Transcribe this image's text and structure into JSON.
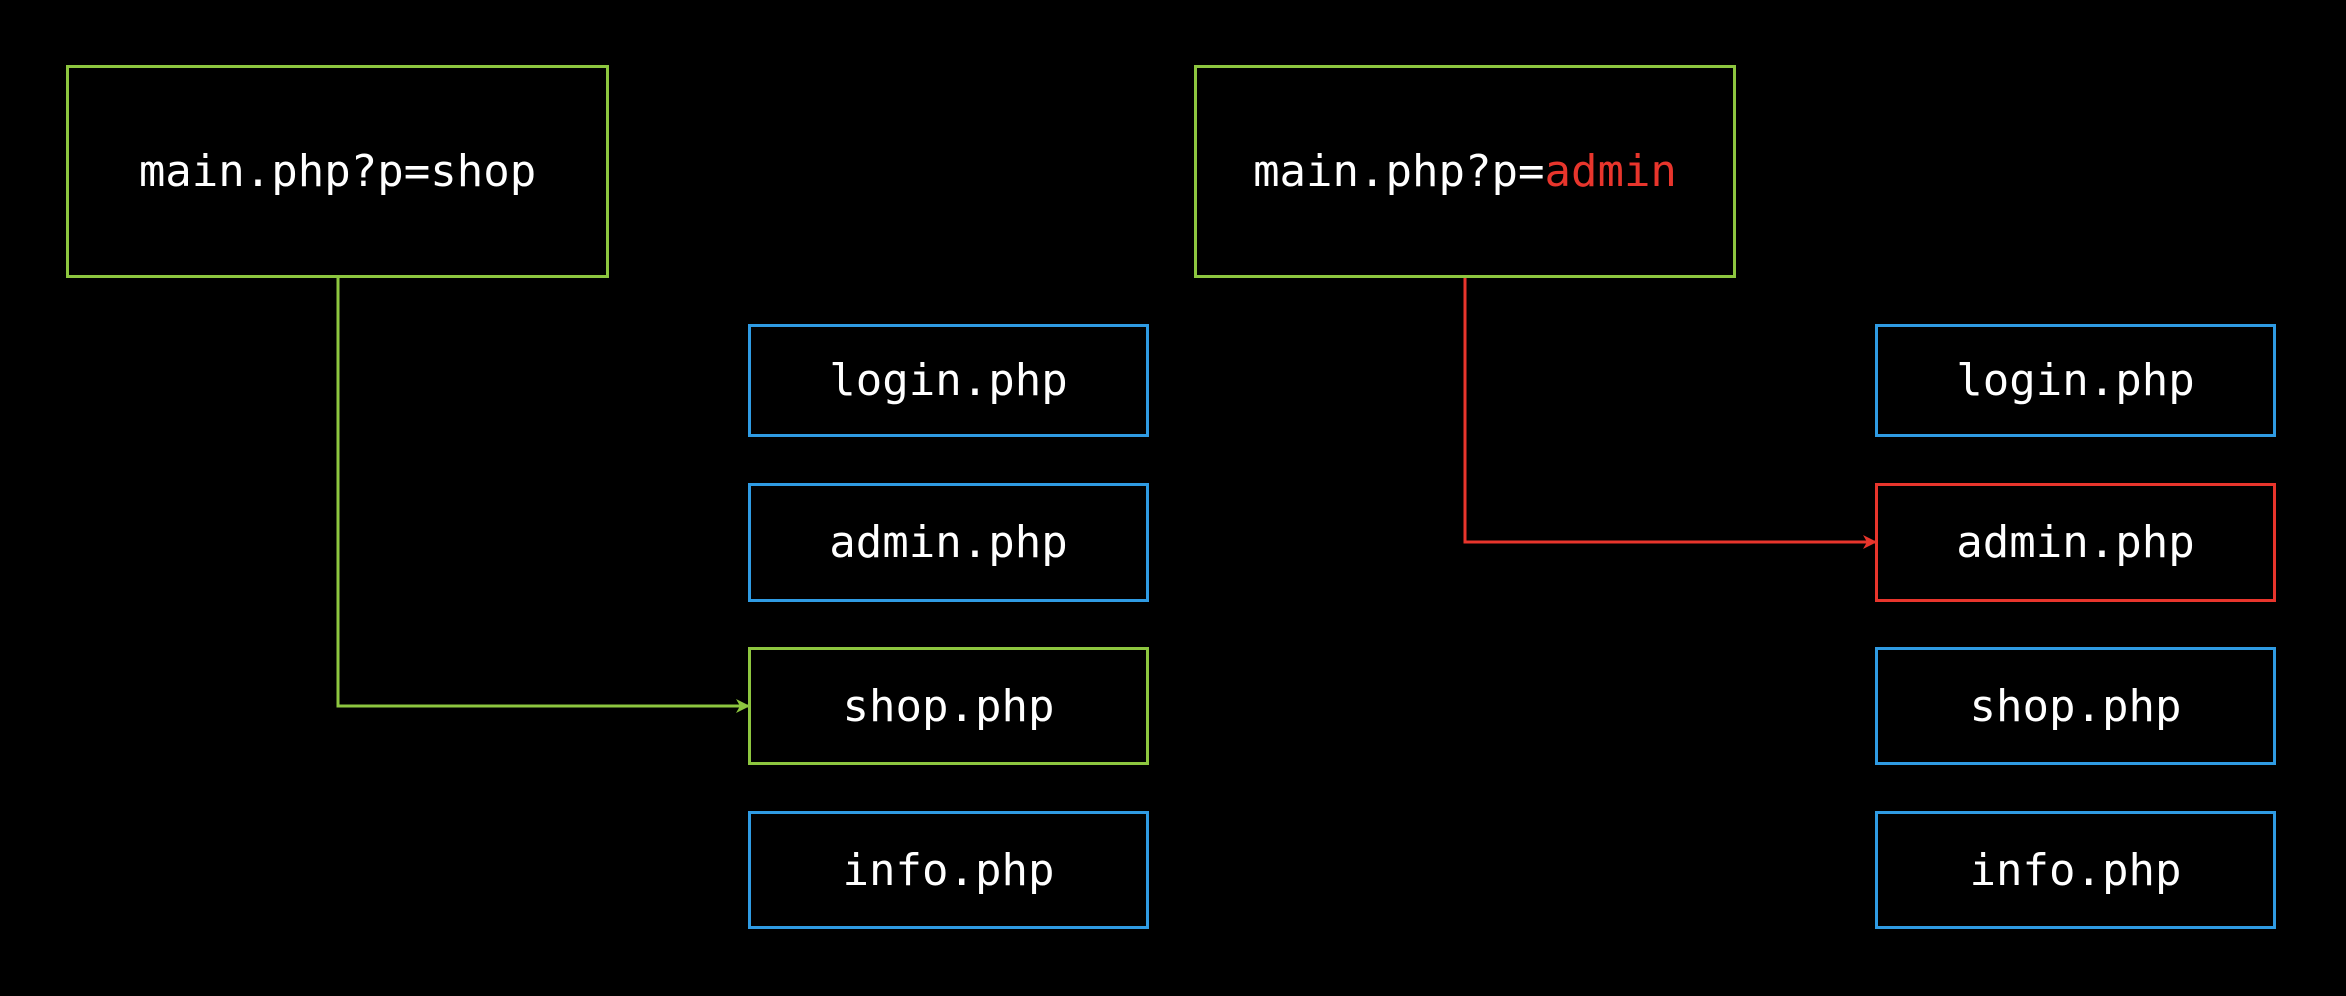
{
  "left": {
    "source": {
      "prefix": "main.php?p=",
      "param": "shop"
    },
    "files": [
      "login.php",
      "admin.php",
      "shop.php",
      "info.php"
    ],
    "target_index": 2
  },
  "right": {
    "source": {
      "prefix": "main.php?p=",
      "param": "admin"
    },
    "files": [
      "login.php",
      "admin.php",
      "shop.php",
      "info.php"
    ],
    "target_index": 1
  },
  "colors": {
    "background": "#000000",
    "text": "#ffffff",
    "source_border": "#8dc63f",
    "file_border": "#2f9be3",
    "valid_target": "#8dc63f",
    "malicious_target": "#e8352c",
    "highlight_text": "#e8352c"
  }
}
